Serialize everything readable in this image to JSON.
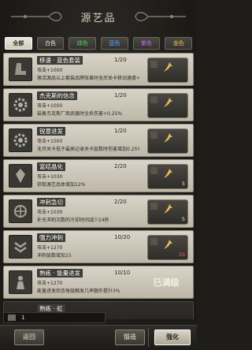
{
  "header": {
    "title": "源艺品"
  },
  "filters": [
    {
      "label": "全部",
      "style": "active"
    },
    {
      "label": "白色",
      "style": "white"
    },
    {
      "label": "绿色",
      "style": "green"
    },
    {
      "label": "蓝色",
      "style": "blue"
    },
    {
      "label": "紫色",
      "style": "purple"
    },
    {
      "label": "金色",
      "style": "gold"
    }
  ],
  "items": [
    {
      "name": "移速 · 蓝色套装",
      "level": "1/20",
      "attr": "攻击+1000",
      "desc": "激活源品以上套装品牌效果时无尽关卡移动速度+0.5%",
      "cost": "",
      "maxed": false,
      "dark": false
    },
    {
      "name": "杰克斯的信念",
      "level": "1/20",
      "attr": "攻击+1000",
      "desc": "装备杰克斯厂商武器时全系伤害+0.25%",
      "cost": "",
      "maxed": false,
      "dark": false
    },
    {
      "name": "锐意进发",
      "level": "1/20",
      "attr": "攻击+1000",
      "desc": "无尽关卡低于最高记录关卡层数时伤害增加0.25%",
      "cost": "",
      "maxed": false,
      "dark": false
    },
    {
      "name": "富结晶化",
      "level": "2/20",
      "attr": "攻击+1030",
      "desc": "获取源艺品体增加12%",
      "cost": "5",
      "cost_red": false,
      "maxed": false,
      "dark": false
    },
    {
      "name": "冲刺急切",
      "level": "2/20",
      "attr": "攻击+1030",
      "desc": "补充冲刺次数的冷却时间减少24秒",
      "cost": "5",
      "cost_red": false,
      "maxed": false,
      "dark": false
    },
    {
      "name": "强力冲刺",
      "level": "10/20",
      "attr": "攻击+1270",
      "desc": "冲刺层数增加15",
      "cost": "29",
      "cost_red": true,
      "maxed": false,
      "dark": false
    },
    {
      "name": "熟练 · 能量进发",
      "level": "10/10",
      "attr": "攻击+1270",
      "desc": "能量进发状态每层触发几率额外提升3%",
      "cost": "",
      "maxed": true,
      "maxed_label": "已满级",
      "dark": false
    },
    {
      "name": "熟练 · 虹",
      "level": "",
      "attr": "",
      "desc": "",
      "cost": "",
      "maxed": false,
      "dark": true
    }
  ],
  "resource": {
    "value": "1"
  },
  "buttons": {
    "back": "返回",
    "forge": "锻造",
    "enhance": "强化"
  },
  "colors": {
    "accent": "#e6b85a",
    "cost_red": "#ff5757"
  }
}
